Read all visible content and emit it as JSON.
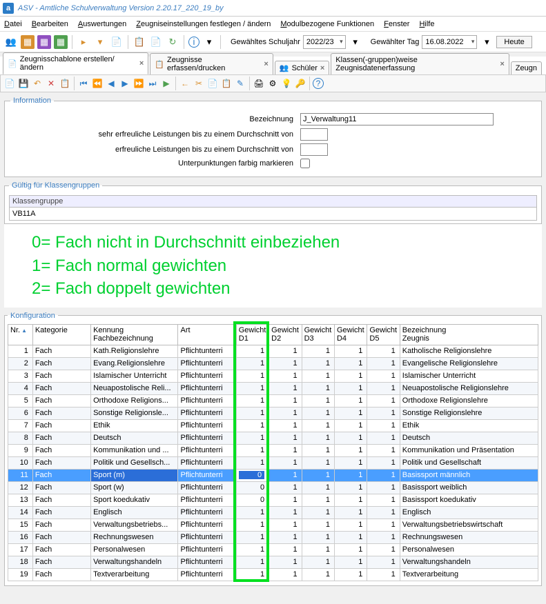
{
  "window": {
    "title": "ASV - Amtliche Schulverwaltung Version 2.20.17_220_19_by",
    "app_icon": "a"
  },
  "menu": [
    "Datei",
    "Bearbeiten",
    "Auswertungen",
    "Zeugniseinstellungen festlegen / ändern",
    "Modulbezogene Funktionen",
    "Fenster",
    "Hilfe"
  ],
  "toolrow": {
    "schuljahr_label": "Gewähltes Schuljahr",
    "schuljahr_value": "2022/23",
    "tag_label": "Gewählter Tag",
    "tag_value": "16.08.2022",
    "heute": "Heute"
  },
  "tabs": [
    {
      "label": "Zeugnisschablone erstellen/ändern",
      "active": true,
      "icon": "📄"
    },
    {
      "label": "Zeugnisse erfassen/drucken",
      "icon": "📋"
    },
    {
      "label": "Schüler",
      "icon": "👥"
    },
    {
      "label": "Klassen(-gruppen)weise Zeugnisdatenerfassung",
      "icon": ""
    },
    {
      "label": "Zeugn",
      "partial": true
    }
  ],
  "info": {
    "legend": "Information",
    "bezeichnung_label": "Bezeichnung",
    "bezeichnung_value": "J_Verwaltung11",
    "sehr_erfreulich_label": "sehr erfreuliche Leistungen bis zu einem Durchschnitt von",
    "erfreulich_label": "erfreuliche Leistungen bis zu einem Durchschnitt von",
    "unterpunkt_label": "Unterpunktungen farbig markieren"
  },
  "klassen": {
    "legend": "Gültig für Klassengruppen",
    "header": "Klassengruppe",
    "value": "VB11A"
  },
  "annotations": [
    "0= Fach nicht in Durchschnitt einbeziehen",
    "1= Fach normal gewichten",
    "2= Fach doppelt gewichten"
  ],
  "konfig": {
    "legend": "Konfiguration",
    "headers": {
      "nr": "Nr.",
      "kat": "Kategorie",
      "ken": "Kennung\nFachbezeichnung",
      "art": "Art",
      "d1": "Gewicht\nD1",
      "d2": "Gewicht\nD2",
      "d3": "Gewicht\nD3",
      "d4": "Gewicht\nD4",
      "d5": "Gewicht\nD5",
      "bez": "Bezeichnung\nZeugnis"
    },
    "rows": [
      {
        "nr": 1,
        "kat": "Fach",
        "ken": "Kath.Religionslehre",
        "art": "Pflichtunterri",
        "d": [
          1,
          1,
          1,
          1,
          1
        ],
        "bez": "Katholische Religionslehre"
      },
      {
        "nr": 2,
        "kat": "Fach",
        "ken": "Evang.Religionslehre",
        "art": "Pflichtunterri",
        "d": [
          1,
          1,
          1,
          1,
          1
        ],
        "bez": "Evangelische Religionslehre"
      },
      {
        "nr": 3,
        "kat": "Fach",
        "ken": "Islamischer Unterricht",
        "art": "Pflichtunterri",
        "d": [
          1,
          1,
          1,
          1,
          1
        ],
        "bez": "Islamischer Unterricht"
      },
      {
        "nr": 4,
        "kat": "Fach",
        "ken": "Neuapostolische Reli...",
        "art": "Pflichtunterri",
        "d": [
          1,
          1,
          1,
          1,
          1
        ],
        "bez": "Neuapostolische Religionslehre"
      },
      {
        "nr": 5,
        "kat": "Fach",
        "ken": "Orthodoxe Religions...",
        "art": "Pflichtunterri",
        "d": [
          1,
          1,
          1,
          1,
          1
        ],
        "bez": "Orthodoxe Religionslehre"
      },
      {
        "nr": 6,
        "kat": "Fach",
        "ken": "Sonstige Religionsle...",
        "art": "Pflichtunterri",
        "d": [
          1,
          1,
          1,
          1,
          1
        ],
        "bez": "Sonstige Religionslehre"
      },
      {
        "nr": 7,
        "kat": "Fach",
        "ken": "Ethik",
        "art": "Pflichtunterri",
        "d": [
          1,
          1,
          1,
          1,
          1
        ],
        "bez": "Ethik"
      },
      {
        "nr": 8,
        "kat": "Fach",
        "ken": "Deutsch",
        "art": "Pflichtunterri",
        "d": [
          1,
          1,
          1,
          1,
          1
        ],
        "bez": "Deutsch"
      },
      {
        "nr": 9,
        "kat": "Fach",
        "ken": "Kommunikation und ...",
        "art": "Pflichtunterri",
        "d": [
          1,
          1,
          1,
          1,
          1
        ],
        "bez": "Kommunikation und Präsentation"
      },
      {
        "nr": 10,
        "kat": "Fach",
        "ken": "Politik und Gesellsch...",
        "art": "Pflichtunterri",
        "d": [
          1,
          1,
          1,
          1,
          1
        ],
        "bez": "Politik und Gesellschaft"
      },
      {
        "nr": 11,
        "kat": "Fach",
        "ken": "Sport (m)",
        "art": "Pflichtunterri",
        "d": [
          0,
          1,
          1,
          1,
          1
        ],
        "bez": "Basissport männlich",
        "selected": true,
        "editing": true
      },
      {
        "nr": 12,
        "kat": "Fach",
        "ken": "Sport (w)",
        "art": "Pflichtunterri",
        "d": [
          0,
          1,
          1,
          1,
          1
        ],
        "bez": "Basissport weiblich"
      },
      {
        "nr": 13,
        "kat": "Fach",
        "ken": "Sport koedukativ",
        "art": "Pflichtunterri",
        "d": [
          0,
          1,
          1,
          1,
          1
        ],
        "bez": "Basissport koedukativ"
      },
      {
        "nr": 14,
        "kat": "Fach",
        "ken": "Englisch",
        "art": "Pflichtunterri",
        "d": [
          1,
          1,
          1,
          1,
          1
        ],
        "bez": "Englisch"
      },
      {
        "nr": 15,
        "kat": "Fach",
        "ken": "Verwaltungsbetriebs...",
        "art": "Pflichtunterri",
        "d": [
          1,
          1,
          1,
          1,
          1
        ],
        "bez": "Verwaltungsbetriebswirtschaft"
      },
      {
        "nr": 16,
        "kat": "Fach",
        "ken": "Rechnungswesen",
        "art": "Pflichtunterri",
        "d": [
          1,
          1,
          1,
          1,
          1
        ],
        "bez": "Rechnungswesen"
      },
      {
        "nr": 17,
        "kat": "Fach",
        "ken": "Personalwesen",
        "art": "Pflichtunterri",
        "d": [
          1,
          1,
          1,
          1,
          1
        ],
        "bez": "Personalwesen"
      },
      {
        "nr": 18,
        "kat": "Fach",
        "ken": "Verwaltungshandeln",
        "art": "Pflichtunterri",
        "d": [
          1,
          1,
          1,
          1,
          1
        ],
        "bez": "Verwaltungshandeln"
      },
      {
        "nr": 19,
        "kat": "Fach",
        "ken": "Textverarbeitung",
        "art": "Pflichtunterri",
        "d": [
          1,
          1,
          1,
          1,
          1
        ],
        "bez": "Textverarbeitung"
      }
    ]
  }
}
